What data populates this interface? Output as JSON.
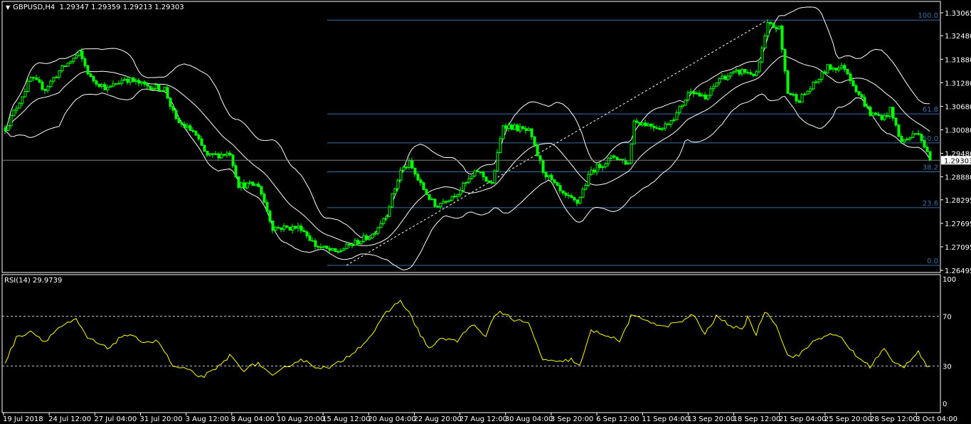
{
  "header": {
    "symbol": "GBPUSD,H4",
    "open": "1.29347",
    "high": "1.29359",
    "low": "1.29213",
    "close": "1.29303"
  },
  "rsi_header": {
    "label": "RSI(14)",
    "value": "29.9739"
  },
  "colors": {
    "background": "#000000",
    "candle": "#00ff00",
    "bands": "#ffffff",
    "fib": "#3a6ea5",
    "rsi": "#ffff00",
    "grid_frame": "#ffffff",
    "price_line": "#808080"
  },
  "chart_data": [
    {
      "type": "candlestick",
      "title": "GBPUSD,H4",
      "timeframe": "H4",
      "indicators": [
        "Bollinger Bands (white)",
        "Fibonacci retracement"
      ],
      "y_ticks": [
        "1.33065",
        "1.32480",
        "1.31880",
        "1.31280",
        "1.30680",
        "1.30080",
        "1.29480",
        "1.28880",
        "1.28295",
        "1.27695",
        "1.27095",
        "1.26495"
      ],
      "ylim": [
        1.26495,
        1.33065
      ],
      "current_price": "1.29303",
      "x_ticks": [
        "19 Jul 2018",
        "24 Jul 12:00",
        "27 Jul 04:00",
        "31 Jul 20:00",
        "3 Aug 12:00",
        "8 Aug 04:00",
        "10 Aug 20:00",
        "15 Aug 12:00",
        "20 Aug 04:00",
        "22 Aug 20:00",
        "27 Aug 12:00",
        "30 Aug 04:00",
        "3 Sep 20:00",
        "6 Sep 12:00",
        "11 Sep 04:00",
        "13 Sep 20:00",
        "18 Sep 12:00",
        "21 Sep 04:00",
        "25 Sep 20:00",
        "28 Sep 12:00",
        "3 Oct 04:00"
      ],
      "bars_per_tick": 16,
      "close_path": [
        [
          0,
          1.30125
        ],
        [
          4,
          1.30669
        ],
        [
          9,
          1.31395
        ],
        [
          14,
          1.31123
        ],
        [
          19,
          1.31577
        ],
        [
          26,
          1.32031
        ],
        [
          30,
          1.31395
        ],
        [
          36,
          1.31123
        ],
        [
          42,
          1.31395
        ],
        [
          49,
          1.31214
        ],
        [
          56,
          1.31123
        ],
        [
          60,
          1.30306
        ],
        [
          66,
          1.30034
        ],
        [
          71,
          1.29399
        ],
        [
          79,
          1.2949
        ],
        [
          82,
          1.28673
        ],
        [
          89,
          1.28673
        ],
        [
          94,
          1.27584
        ],
        [
          104,
          1.27584
        ],
        [
          109,
          1.2713
        ],
        [
          116,
          1.26949
        ],
        [
          121,
          1.2713
        ],
        [
          129,
          1.27403
        ],
        [
          134,
          1.27947
        ],
        [
          139,
          1.29036
        ],
        [
          142,
          1.29217
        ],
        [
          146,
          1.28673
        ],
        [
          151,
          1.28129
        ],
        [
          159,
          1.28491
        ],
        [
          166,
          1.29036
        ],
        [
          171,
          1.28673
        ],
        [
          175,
          1.30216
        ],
        [
          184,
          1.30034
        ],
        [
          189,
          1.29036
        ],
        [
          196,
          1.28401
        ],
        [
          201,
          1.28219
        ],
        [
          206,
          1.29036
        ],
        [
          214,
          1.29399
        ],
        [
          219,
          1.29217
        ],
        [
          221,
          1.30306
        ],
        [
          226,
          1.30216
        ],
        [
          231,
          1.30125
        ],
        [
          236,
          1.30488
        ],
        [
          241,
          1.31123
        ],
        [
          246,
          1.30851
        ],
        [
          251,
          1.31395
        ],
        [
          259,
          1.31577
        ],
        [
          264,
          1.31486
        ],
        [
          268,
          1.32756
        ],
        [
          272,
          1.32666
        ],
        [
          275,
          1.31032
        ],
        [
          279,
          1.30851
        ],
        [
          284,
          1.31214
        ],
        [
          289,
          1.31668
        ],
        [
          295,
          1.31668
        ],
        [
          299,
          1.31123
        ],
        [
          304,
          1.30488
        ],
        [
          309,
          1.30397
        ],
        [
          311,
          1.30579
        ],
        [
          315,
          1.29762
        ],
        [
          321,
          1.30034
        ],
        [
          325,
          1.29303
        ]
      ],
      "fibonacci": {
        "levels": [
          {
            "label": "100.0",
            "price": 1.3288
          },
          {
            "label": "61.8",
            "price": 1.30486
          },
          {
            "label": "50.0",
            "price": 1.29747
          },
          {
            "label": "38.2",
            "price": 1.29008
          },
          {
            "label": "23.6",
            "price": 1.28094
          },
          {
            "label": "0.0",
            "price": 1.26622
          }
        ],
        "trend_from": {
          "bar": 120,
          "price": 1.26622
        },
        "trend_to": {
          "bar": 268,
          "price": 1.3288
        }
      }
    },
    {
      "type": "line",
      "title": "RSI(14) 29.9739",
      "series": [
        {
          "name": "RSI(14)",
          "color": "#ffff00"
        }
      ],
      "ylim": [
        0,
        100
      ],
      "y_ticks": [
        "100",
        "70",
        "30",
        "0"
      ],
      "levels": [
        70,
        30
      ],
      "points": [
        [
          0,
          32.6
        ],
        [
          4,
          52.6
        ],
        [
          9,
          58.3
        ],
        [
          14,
          49.7
        ],
        [
          19,
          61.1
        ],
        [
          25,
          66.9
        ],
        [
          29,
          52.6
        ],
        [
          36,
          44
        ],
        [
          42,
          55.4
        ],
        [
          49,
          49.7
        ],
        [
          54,
          49.7
        ],
        [
          59,
          29.7
        ],
        [
          64,
          26.9
        ],
        [
          69,
          21.1
        ],
        [
          74,
          26.9
        ],
        [
          79,
          38.3
        ],
        [
          84,
          26.9
        ],
        [
          89,
          32.6
        ],
        [
          94,
          21.1
        ],
        [
          99,
          29.7
        ],
        [
          104,
          35.4
        ],
        [
          109,
          29.7
        ],
        [
          114,
          28
        ],
        [
          119,
          35.4
        ],
        [
          124,
          44
        ],
        [
          129,
          55.4
        ],
        [
          134,
          72.6
        ],
        [
          139,
          82.9
        ],
        [
          142,
          72.6
        ],
        [
          146,
          55.4
        ],
        [
          149,
          44
        ],
        [
          154,
          52.6
        ],
        [
          159,
          49.7
        ],
        [
          164,
          64
        ],
        [
          169,
          52.6
        ],
        [
          171,
          66.9
        ],
        [
          174,
          74.3
        ],
        [
          179,
          66.9
        ],
        [
          184,
          64
        ],
        [
          189,
          35.4
        ],
        [
          194,
          32.6
        ],
        [
          199,
          35.4
        ],
        [
          202,
          29.7
        ],
        [
          206,
          58.3
        ],
        [
          211,
          55.4
        ],
        [
          216,
          49.7
        ],
        [
          220,
          69.7
        ],
        [
          226,
          66.9
        ],
        [
          231,
          61.1
        ],
        [
          239,
          66.9
        ],
        [
          242,
          71.4
        ],
        [
          246,
          55.4
        ],
        [
          250,
          69.7
        ],
        [
          254,
          64
        ],
        [
          259,
          58.3
        ],
        [
          261,
          69.7
        ],
        [
          264,
          55.4
        ],
        [
          267,
          74.3
        ],
        [
          271,
          64
        ],
        [
          275,
          38.3
        ],
        [
          279,
          38.3
        ],
        [
          284,
          49.7
        ],
        [
          289,
          55.4
        ],
        [
          294,
          52.6
        ],
        [
          299,
          38.3
        ],
        [
          304,
          29.7
        ],
        [
          309,
          44
        ],
        [
          312,
          32.6
        ],
        [
          316,
          29.7
        ],
        [
          321,
          42.3
        ],
        [
          324,
          29.7
        ],
        [
          325,
          29.97
        ]
      ]
    }
  ]
}
